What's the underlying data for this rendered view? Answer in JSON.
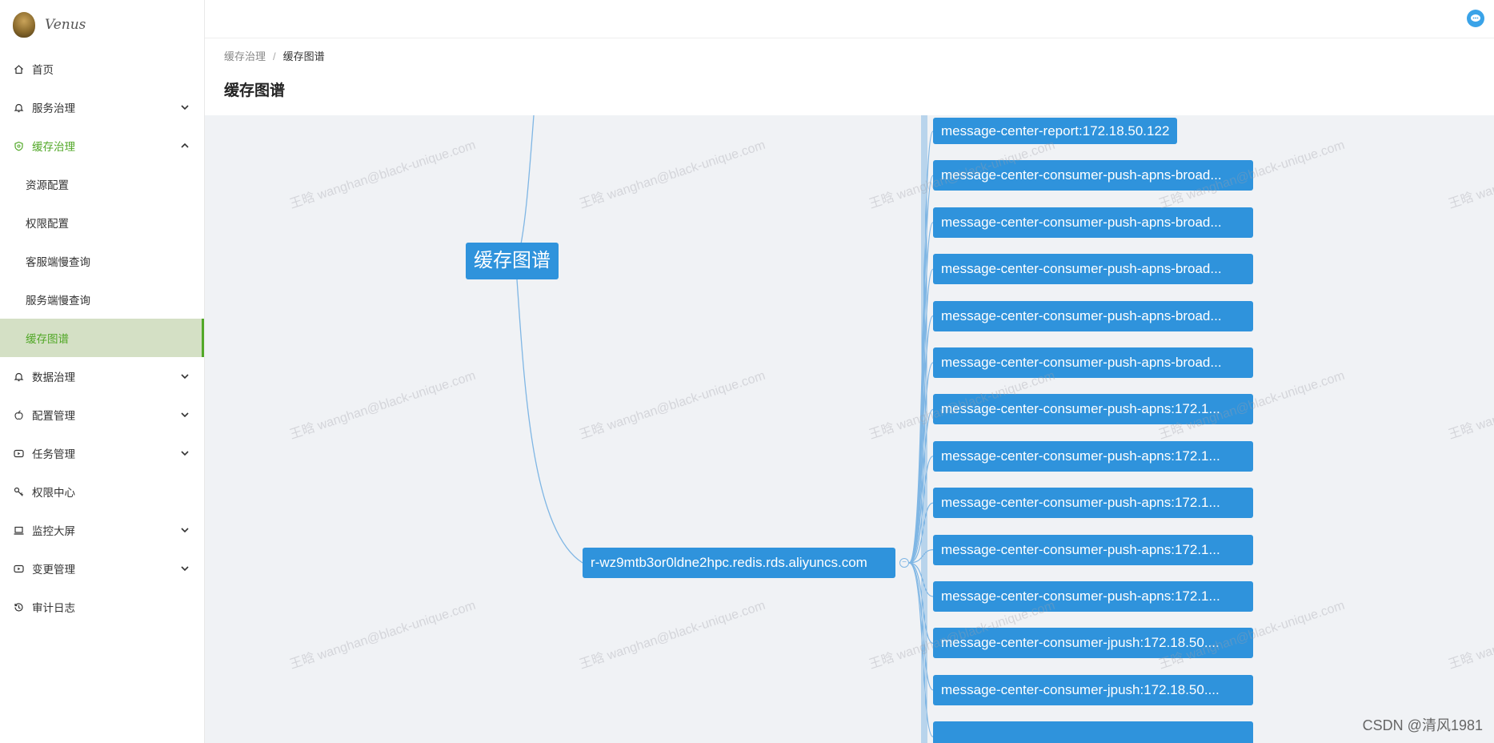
{
  "app": {
    "brand": "Venus"
  },
  "sidebar": {
    "items": [
      {
        "label": "首页",
        "icon": "home-icon",
        "has_arrow": false,
        "state": ""
      },
      {
        "label": "服务治理",
        "icon": "bell-icon",
        "has_arrow": true,
        "state": "collapsed"
      },
      {
        "label": "缓存治理",
        "icon": "shield-icon",
        "has_arrow": true,
        "state": "open"
      },
      {
        "label": "资源配置",
        "sub": true
      },
      {
        "label": "权限配置",
        "sub": true
      },
      {
        "label": "客服端慢查询",
        "sub": true
      },
      {
        "label": "服务端慢查询",
        "sub": true
      },
      {
        "label": "缓存图谱",
        "sub": true,
        "active": true
      },
      {
        "label": "数据治理",
        "icon": "bell-icon",
        "has_arrow": true,
        "state": "collapsed"
      },
      {
        "label": "配置管理",
        "icon": "apple-icon",
        "has_arrow": true,
        "state": "collapsed"
      },
      {
        "label": "任务管理",
        "icon": "youtube-icon",
        "has_arrow": true,
        "state": "collapsed"
      },
      {
        "label": "权限中心",
        "icon": "key-icon",
        "has_arrow": false,
        "state": ""
      },
      {
        "label": "监控大屏",
        "icon": "laptop-icon",
        "has_arrow": true,
        "state": "collapsed"
      },
      {
        "label": "变更管理",
        "icon": "youtube-icon",
        "has_arrow": true,
        "state": "collapsed"
      },
      {
        "label": "审计日志",
        "icon": "history-icon",
        "has_arrow": false,
        "state": ""
      }
    ]
  },
  "breadcrumb": {
    "parent": "缓存治理",
    "separator": "/",
    "current": "缓存图谱"
  },
  "page": {
    "title": "缓存图谱"
  },
  "graph": {
    "root": "缓存图谱",
    "redis_node": "r-wz9mtb3or0ldne2hpc.redis.rds.aliyuncs.com",
    "collapse_symbol": "−",
    "leaves": [
      "message-center-report:172.18.50.122",
      "message-center-consumer-push-apns-broad...",
      "message-center-consumer-push-apns-broad...",
      "message-center-consumer-push-apns-broad...",
      "message-center-consumer-push-apns-broad...",
      "message-center-consumer-push-apns-broad...",
      "message-center-consumer-push-apns:172.1...",
      "message-center-consumer-push-apns:172.1...",
      "message-center-consumer-push-apns:172.1...",
      "message-center-consumer-push-apns:172.1...",
      "message-center-consumer-push-apns:172.1...",
      "message-center-consumer-jpush:172.18.50....",
      "message-center-consumer-jpush:172.18.50....",
      ""
    ]
  },
  "watermark": "王晗 wanghan@black-unique.com",
  "footer": {
    "credit": "CSDN @清风1981"
  },
  "colors": {
    "accent": "#52a828",
    "node": "#2f93dc",
    "link": "#7fb6e4",
    "canvas": "#f0f2f5"
  }
}
